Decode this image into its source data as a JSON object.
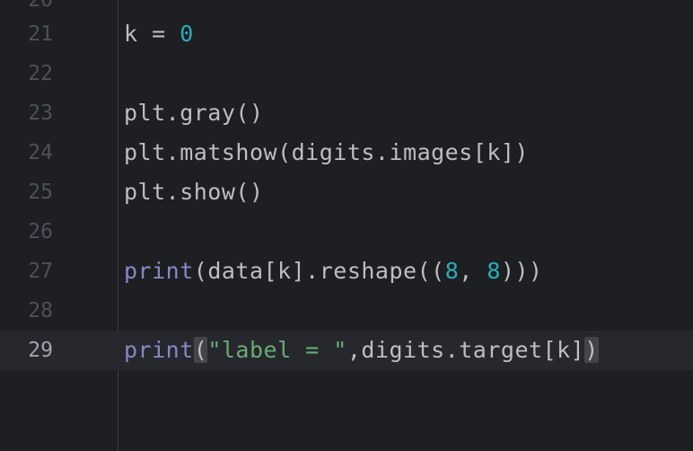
{
  "editor": {
    "colors": {
      "background": "#1e1f22",
      "current_line": "#26282e",
      "number": "#2aacb8",
      "builtin": "#8888c6",
      "string": "#6aab73",
      "text": "#bcbec4"
    },
    "partial_top_line_number": "20",
    "current_line_number": "29",
    "lines": [
      {
        "number": "21",
        "tokens": [
          "k = ",
          "0"
        ]
      },
      {
        "number": "22",
        "tokens": []
      },
      {
        "number": "23",
        "tokens": [
          "plt.gray()"
        ]
      },
      {
        "number": "24",
        "tokens": [
          "plt.matshow(digits.images[k])"
        ]
      },
      {
        "number": "25",
        "tokens": [
          "plt.show()"
        ]
      },
      {
        "number": "26",
        "tokens": []
      },
      {
        "number": "27",
        "tokens": [
          "print",
          "(data[k].reshape((",
          "8",
          ", ",
          "8",
          ")))"
        ]
      },
      {
        "number": "28",
        "tokens": []
      },
      {
        "number": "29",
        "tokens": [
          "print",
          "(",
          "\"label = \"",
          ",digits.target[k]",
          ")"
        ]
      }
    ]
  }
}
